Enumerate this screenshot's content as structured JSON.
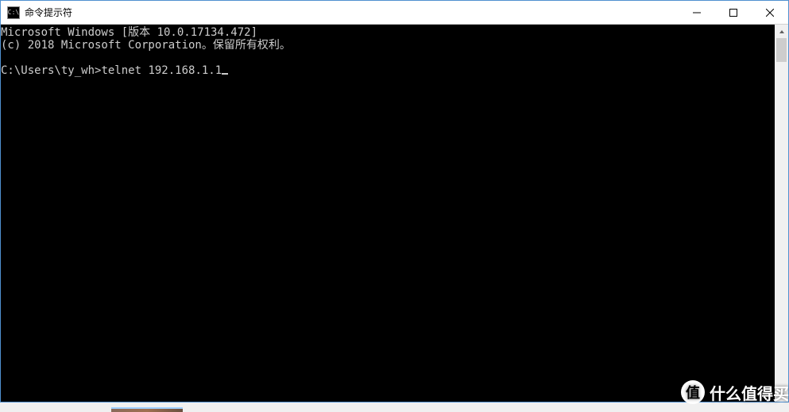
{
  "window": {
    "title": "命令提示符",
    "icon_label": "C:\\"
  },
  "terminal": {
    "line1": "Microsoft Windows [版本 10.0.17134.472]",
    "line2": "(c) 2018 Microsoft Corporation。保留所有权利。",
    "blank": "",
    "prompt": "C:\\Users\\ty_wh>",
    "command": "telnet 192.168.1.1"
  },
  "watermark": {
    "badge": "值",
    "text": "什么值得买"
  }
}
